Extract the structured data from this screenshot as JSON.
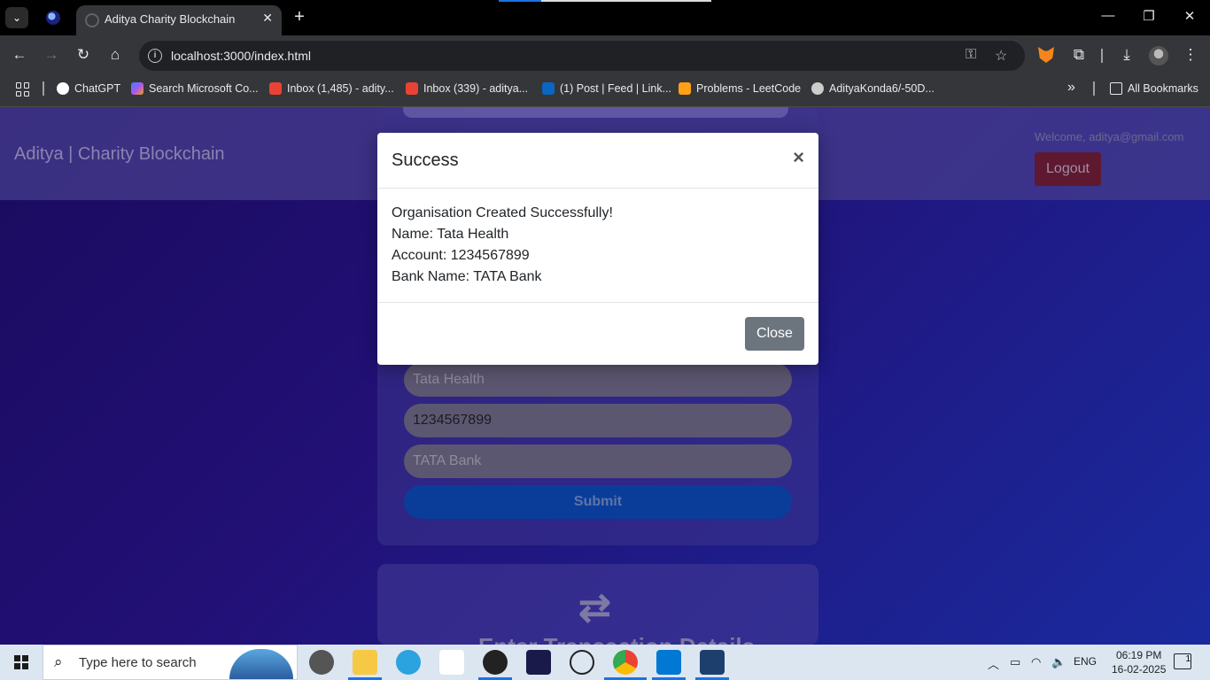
{
  "browser": {
    "tab_title": "Aditya Charity Blockchain",
    "tab_close": "✕",
    "new_tab": "+",
    "url": "localhost:3000/index.html",
    "window_controls": {
      "minimize": "—",
      "restore": "❐",
      "close": "✕"
    },
    "icons": [
      "back-icon",
      "forward-icon",
      "reload-icon",
      "home-icon",
      "key-icon",
      "star-icon",
      "metamask-icon",
      "extensions-icon",
      "download-icon",
      "profile-icon",
      "kebab-menu-icon"
    ]
  },
  "bookmarks": [
    {
      "label": "ChatGPT",
      "icon_color": "#ffffff"
    },
    {
      "label": "Search Microsoft Co...",
      "icon_color": "#8a63d2"
    },
    {
      "label": "Inbox (1,485) - adity...",
      "icon_color": "#ea4335"
    },
    {
      "label": "Inbox (339) - aditya...",
      "icon_color": "#ea4335"
    },
    {
      "label": "(1) Post | Feed | Link...",
      "icon_color": "#0a66c2"
    },
    {
      "label": "Problems - LeetCode",
      "icon_color": "#ffa116"
    },
    {
      "label": "AdityaKonda6/-50D...",
      "icon_color": "#cccccc"
    }
  ],
  "bookmarks_overflow": "»",
  "all_bookmarks": "All Bookmarks",
  "page": {
    "brand": "Aditya | Charity Blockchain",
    "welcome": "Welcome, aditya@gmail.com",
    "logout": "Logout",
    "form": {
      "name_value": "Tata Health",
      "account_value": "1234567899",
      "bank_value": "TATA Bank",
      "submit": "Submit"
    },
    "transaction_card": {
      "icon": "⇄",
      "title": "Enter Transaction Details"
    }
  },
  "modal": {
    "title": "Success",
    "close_x": "×",
    "lines": [
      "Organisation Created Successfully!",
      "Name: Tata Health",
      "Account: 1234567899",
      "Bank Name: TATA Bank"
    ],
    "close_button": "Close"
  },
  "taskbar": {
    "search_placeholder": "Type here to search",
    "apps": [
      "snipping-tool",
      "file-explorer",
      "telegram",
      "unstop",
      "github-desktop",
      "intellij",
      "chatgpt",
      "chrome",
      "vscode",
      "virtualbox"
    ],
    "language": "ENG",
    "time": "06:19 PM",
    "date": "16-02-2025",
    "notifications": "1"
  }
}
